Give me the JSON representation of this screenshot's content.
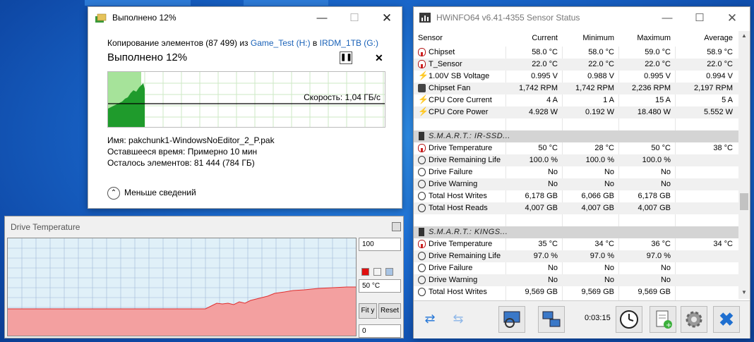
{
  "copy_dialog": {
    "title": "Выполнено 12%",
    "line_prefix": "Копирование элементов (87 499) из ",
    "source": "Game_Test (H:)",
    "line_mid": " в ",
    "destination": "IRDM_1TB (G:)",
    "heading": "Выполнено 12%",
    "progress_percent": 12,
    "speed_label": "Скорость: 1,04 ГБ/с",
    "name_line": "Имя:  pakchunk1-WindowsNoEditor_2_P.pak",
    "time_line": "Оставшееся время:  Примерно 10 мин",
    "items_line": "Осталось элементов:  81 444 (784 ГБ)",
    "less_details": "Меньше сведений"
  },
  "drive_temp": {
    "title": "Drive Temperature",
    "max_value": "100",
    "current_value": "50 °C",
    "min_value": "0",
    "fit_label": "Fit y",
    "reset_label": "Reset",
    "colors": {
      "fill": "#f3a0a0",
      "line": "#e03030",
      "background": "#e0f0f8",
      "grid": "#9fb8d8"
    }
  },
  "hwinfo": {
    "title": "HWiNFO64 v6.41-4355 Sensor Status",
    "headers": {
      "sensor": "Sensor",
      "current": "Current",
      "minimum": "Minimum",
      "maximum": "Maximum",
      "average": "Average"
    },
    "rows": [
      {
        "icon": "therm",
        "name": "Chipset",
        "cur": "58.0 °C",
        "min": "58.0 °C",
        "max": "59.0 °C",
        "avg": "58.9 °C"
      },
      {
        "icon": "therm",
        "name": "T_Sensor",
        "cur": "22.0 °C",
        "min": "22.0 °C",
        "max": "22.0 °C",
        "avg": "22.0 °C"
      },
      {
        "icon": "bolt",
        "name": "1.00V SB Voltage",
        "cur": "0.995 V",
        "min": "0.988 V",
        "max": "0.995 V",
        "avg": "0.994 V"
      },
      {
        "icon": "fan",
        "name": "Chipset Fan",
        "cur": "1,742 RPM",
        "min": "1,742 RPM",
        "max": "2,236 RPM",
        "avg": "2,197 RPM"
      },
      {
        "icon": "bolt",
        "name": "CPU Core Current",
        "cur": "4 A",
        "min": "1 A",
        "max": "15 A",
        "avg": "5 A"
      },
      {
        "icon": "bolt",
        "name": "CPU Core Power",
        "cur": "4.928 W",
        "min": "0.192 W",
        "max": "18.480 W",
        "avg": "5.552 W"
      },
      {
        "icon": "blank",
        "name": "",
        "cur": "",
        "min": "",
        "max": "",
        "avg": ""
      },
      {
        "icon": "group",
        "name": "S.M.A.R.T.: IR-SSD...",
        "cur": "",
        "min": "",
        "max": "",
        "avg": ""
      },
      {
        "icon": "therm",
        "name": "Drive Temperature",
        "cur": "50 °C",
        "min": "28 °C",
        "max": "50 °C",
        "avg": "38 °C"
      },
      {
        "icon": "circ",
        "name": "Drive Remaining Life",
        "cur": "100.0 %",
        "min": "100.0 %",
        "max": "100.0 %",
        "avg": ""
      },
      {
        "icon": "circ",
        "name": "Drive Failure",
        "cur": "No",
        "min": "No",
        "max": "No",
        "avg": ""
      },
      {
        "icon": "circ",
        "name": "Drive Warning",
        "cur": "No",
        "min": "No",
        "max": "No",
        "avg": ""
      },
      {
        "icon": "circ",
        "name": "Total Host Writes",
        "cur": "6,178 GB",
        "min": "6,066 GB",
        "max": "6,178 GB",
        "avg": ""
      },
      {
        "icon": "circ",
        "name": "Total Host Reads",
        "cur": "4,007 GB",
        "min": "4,007 GB",
        "max": "4,007 GB",
        "avg": ""
      },
      {
        "icon": "blank",
        "name": "",
        "cur": "",
        "min": "",
        "max": "",
        "avg": ""
      },
      {
        "icon": "group",
        "name": "S.M.A.R.T.: KINGS...",
        "cur": "",
        "min": "",
        "max": "",
        "avg": ""
      },
      {
        "icon": "therm",
        "name": "Drive Temperature",
        "cur": "35 °C",
        "min": "34 °C",
        "max": "36 °C",
        "avg": "34 °C"
      },
      {
        "icon": "circ",
        "name": "Drive Remaining Life",
        "cur": "97.0 %",
        "min": "97.0 %",
        "max": "97.0 %",
        "avg": ""
      },
      {
        "icon": "circ",
        "name": "Drive Failure",
        "cur": "No",
        "min": "No",
        "max": "No",
        "avg": ""
      },
      {
        "icon": "circ",
        "name": "Drive Warning",
        "cur": "No",
        "min": "No",
        "max": "No",
        "avg": ""
      },
      {
        "icon": "circ",
        "name": "Total Host Writes",
        "cur": "9,569 GB",
        "min": "9,569 GB",
        "max": "9,569 GB",
        "avg": ""
      }
    ],
    "timer": "0:03:15",
    "toolbar_icons": [
      "nav-left-right-icon",
      "nav-collapse-icon",
      "monitor-search-icon",
      "network-icon",
      "clock-icon",
      "report-add-icon",
      "settings-icon",
      "close-x-icon"
    ]
  }
}
